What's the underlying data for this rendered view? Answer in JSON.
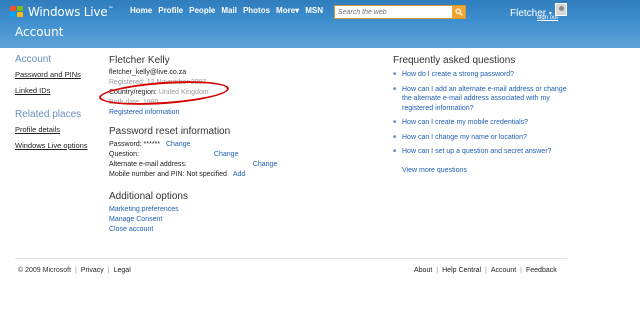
{
  "brand": {
    "name": "Windows Live",
    "tm": "™"
  },
  "topnav": {
    "items": [
      "Home",
      "Profile",
      "People",
      "Mail",
      "Photos",
      "More",
      "MSN"
    ],
    "more_caret": "▾"
  },
  "search": {
    "placeholder": "Search the web"
  },
  "user": {
    "name": "Fletcher",
    "caret": "▾",
    "signout": "sign out"
  },
  "page_title": "Account",
  "sidebar": {
    "account_heading": "Account",
    "account_items": [
      "Password and PINs",
      "Linked IDs"
    ],
    "related_heading": "Related places",
    "related_items": [
      "Profile details",
      "Windows Live options"
    ]
  },
  "profile": {
    "name": "Fletcher Kelly",
    "email": "fletcher_kelly@live.co.za",
    "registered_label": "Registered:",
    "registered_value": "12 November 2007",
    "country_label": "Country/region:",
    "country_value": "United Kingdom",
    "birth_label": "Birth date:",
    "birth_value": "1980",
    "registered_info_link": "Registered information"
  },
  "password_reset": {
    "title": "Password reset information",
    "password_label": "Password:",
    "password_value": "******",
    "change_label": "Change",
    "question_label": "Question:",
    "alt_email_label": "Alternate e-mail address:",
    "mobile_label": "Mobile number and PIN:",
    "mobile_value": "Not specified",
    "add_label": "Add"
  },
  "additional": {
    "title": "Additional options",
    "links": [
      "Marketing preferences",
      "Manage Consent",
      "Close account"
    ]
  },
  "faq": {
    "title": "Frequently asked questions",
    "items": [
      "How do I create a strong password?",
      "How can I add an alternate e-mail address or change the alternate e-mail address associated with my registered information?",
      "How can I create my mobile credentials?",
      "How can I change my name or location?",
      "How can I set up a question and secret answer?"
    ],
    "more": "View more questions"
  },
  "footer": {
    "left": [
      "© 2009 Microsoft",
      "Privacy",
      "Legal"
    ],
    "right": [
      "About",
      "Help Central",
      "Account",
      "Feedback"
    ],
    "separator": "|"
  },
  "colors": {
    "header": "#3f8fcf",
    "link": "#1e5fb3",
    "highlight": "#d40000",
    "search_button": "#f2a533"
  }
}
